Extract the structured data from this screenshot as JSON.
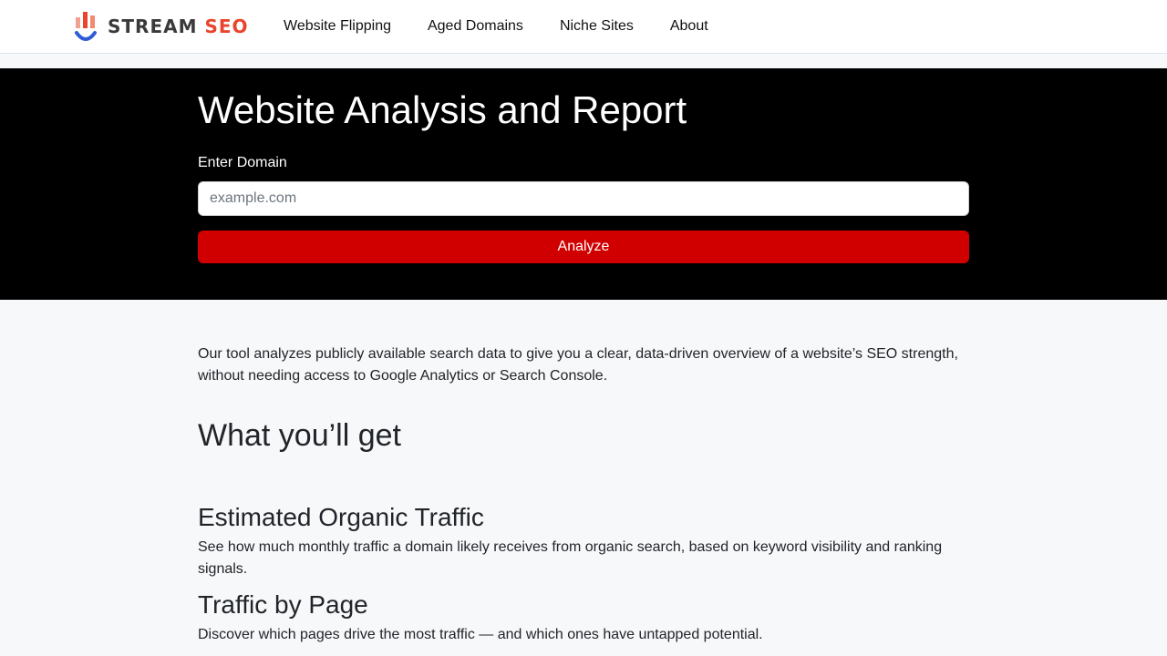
{
  "brand": {
    "name_part1": "STREAM",
    "name_part2": "SEO",
    "colors": {
      "dark": "#3a3a3a",
      "accent": "#e8452c",
      "blue": "#2f5bd6"
    }
  },
  "nav": {
    "items": [
      "Website Flipping",
      "Aged Domains",
      "Niche Sites",
      "About"
    ]
  },
  "hero": {
    "title": "Website Analysis and Report",
    "domain_label": "Enter Domain",
    "domain_placeholder": "example.com",
    "domain_value": "",
    "analyze_label": "Analyze",
    "button_color": "#d10000"
  },
  "content": {
    "intro": "Our tool analyzes publicly available search data to give you a clear, data-driven overview of a website’s SEO strength, without needing access to Google Analytics or Search Console.",
    "section_title": "What you’ll get",
    "features": [
      {
        "title": "Estimated Organic Traffic",
        "desc": "See how much monthly traffic a domain likely receives from organic search, based on keyword visibility and ranking signals."
      },
      {
        "title": "Traffic by Page",
        "desc": "Discover which pages drive the most traffic — and which ones have untapped potential."
      }
    ]
  }
}
